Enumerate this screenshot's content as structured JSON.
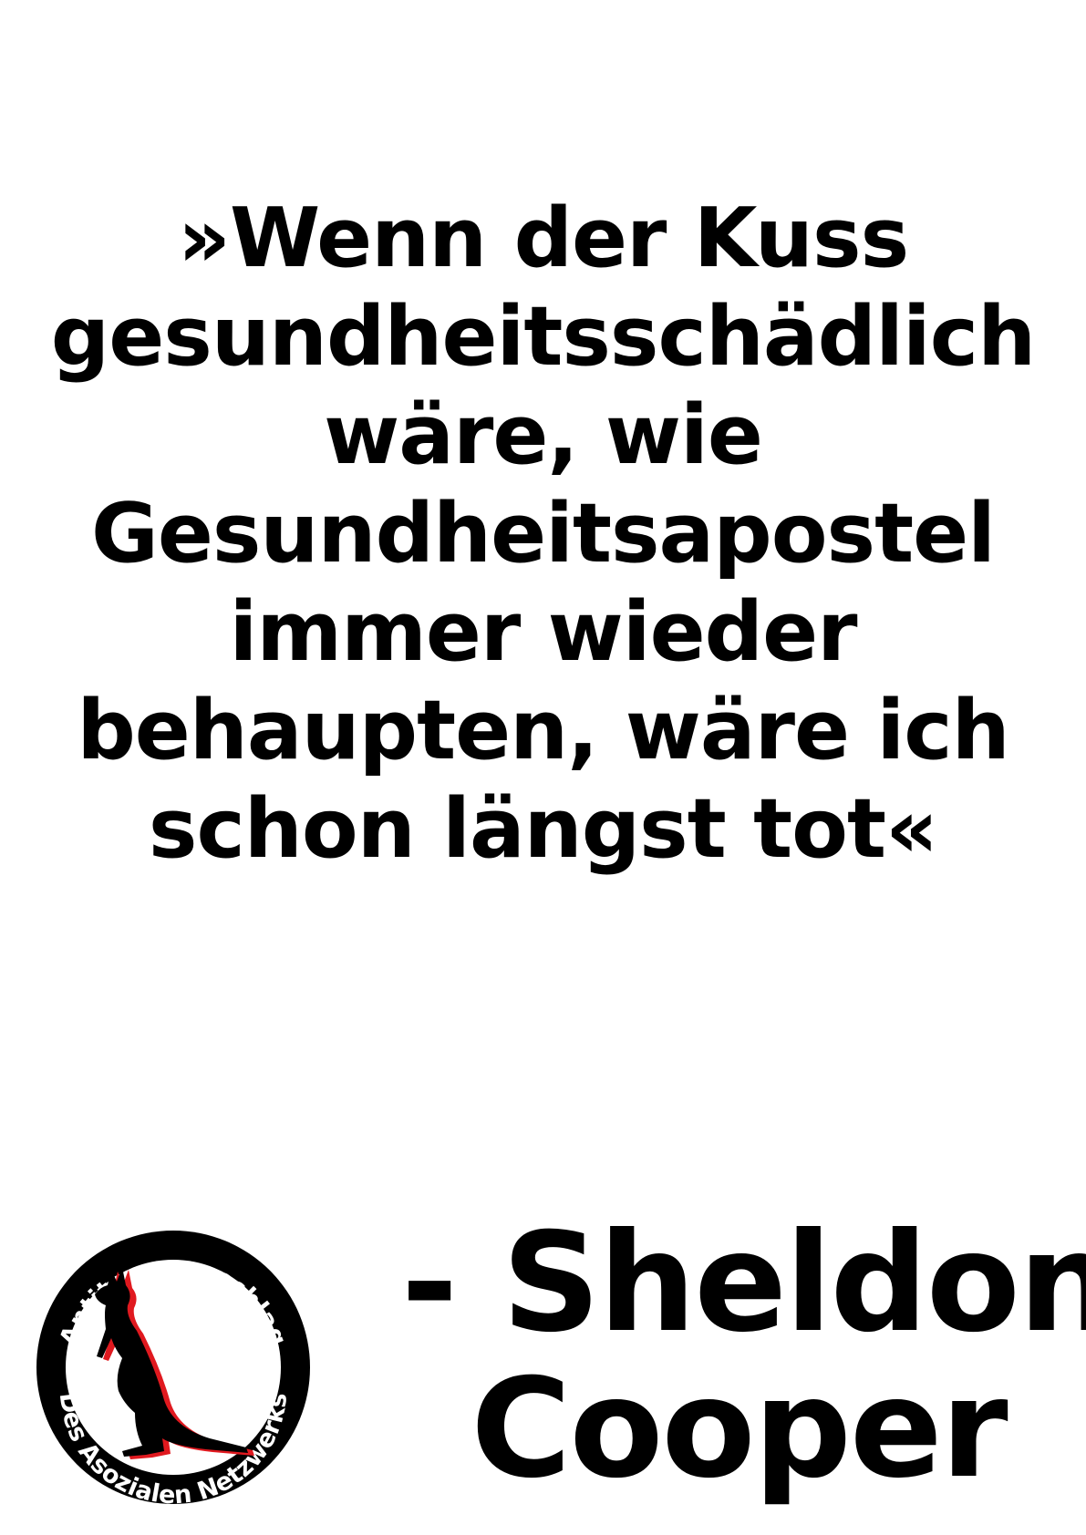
{
  "quote": {
    "lines": [
      "»Wenn der Kuss",
      "gesundheitsschädlich",
      "wäre, wie",
      "Gesundheitsapostel",
      "immer wieder",
      "behaupten, wäre ich",
      "schon längst tot«"
    ]
  },
  "attribution": {
    "lines": [
      "- Sheldon",
      "Cooper"
    ]
  },
  "logo": {
    "top_text": "Antiterroranschlag",
    "bottom_text": "Des Asozialen Netzwerks",
    "icon": "kangaroo-icon",
    "colors": {
      "ring": "#000000",
      "kangaroo": "#000000",
      "shadow": "#e0191f",
      "background": "#ffffff"
    }
  }
}
